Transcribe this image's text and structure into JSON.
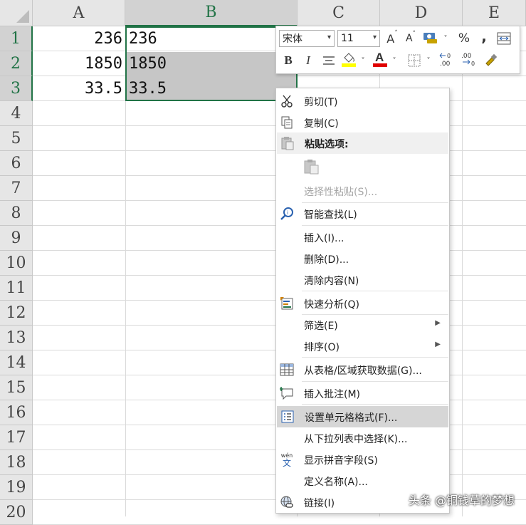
{
  "columns": [
    "A",
    "B",
    "C",
    "D",
    "E"
  ],
  "rows": [
    "1",
    "2",
    "3",
    "4",
    "5",
    "6",
    "7",
    "8",
    "9",
    "10",
    "11",
    "12",
    "13",
    "14",
    "15",
    "16",
    "17",
    "18",
    "19",
    "20"
  ],
  "cells": {
    "A1": "236",
    "B1": "236",
    "A2": "1850",
    "B2": "1850",
    "A3": "33.5",
    "B3": "33.5"
  },
  "mini_toolbar": {
    "font_name": "宋体",
    "font_size": "11",
    "grow_label": "A",
    "shrink_label": "A",
    "percent": "%",
    "comma": ",",
    "bold": "B",
    "italic": "I",
    "font_color_label": "A",
    "dec_increase": ".00",
    "dec_decrease": ".00",
    "fill_color": "#ffff00",
    "text_color": "#e00000"
  },
  "menu": {
    "items": [
      {
        "label": "剪切(T)",
        "icon": "scissors-icon"
      },
      {
        "label": "复制(C)",
        "icon": "copy-icon"
      },
      {
        "label": "粘贴选项:",
        "icon": "paste-icon"
      },
      {
        "label": "选择性粘贴(S)...",
        "icon": ""
      },
      {
        "label": "智能查找(L)",
        "icon": "smart-lookup-icon"
      },
      {
        "label": "插入(I)...",
        "icon": ""
      },
      {
        "label": "删除(D)...",
        "icon": ""
      },
      {
        "label": "清除内容(N)",
        "icon": ""
      },
      {
        "label": "快速分析(Q)",
        "icon": "quick-analysis-icon"
      },
      {
        "label": "筛选(E)",
        "icon": ""
      },
      {
        "label": "排序(O)",
        "icon": ""
      },
      {
        "label": "从表格/区域获取数据(G)...",
        "icon": "table-icon"
      },
      {
        "label": "插入批注(M)",
        "icon": "comment-icon"
      },
      {
        "label": "设置单元格格式(F)...",
        "icon": "format-cells-icon"
      },
      {
        "label": "从下拉列表中选择(K)...",
        "icon": ""
      },
      {
        "label": "显示拼音字段(S)",
        "icon": "phonetic-icon"
      },
      {
        "label": "定义名称(A)...",
        "icon": ""
      },
      {
        "label": "链接(I)",
        "icon": "link-icon"
      }
    ],
    "phonetic_glyph_top": "wén",
    "phonetic_glyph_bottom": "文"
  },
  "watermark": "头条 @铜钱草的梦想",
  "colors": {
    "accent": "#217346",
    "selection": "#c6c6c6",
    "highlight": "#d6d6d6"
  }
}
